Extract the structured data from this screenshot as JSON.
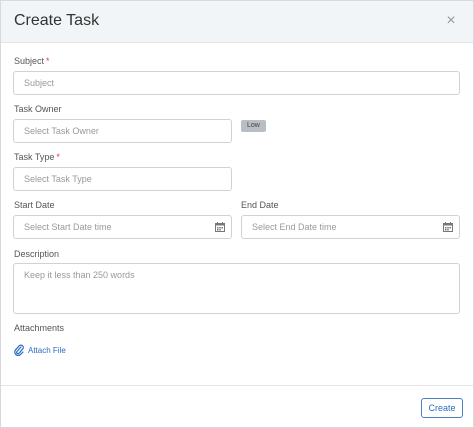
{
  "modal": {
    "title": "Create Task",
    "close_icon": "×"
  },
  "fields": {
    "subject": {
      "label": "Subject",
      "required": "*",
      "placeholder": "Subject",
      "value": ""
    },
    "task_owner": {
      "label": "Task Owner",
      "placeholder": "Select Task Owner",
      "value": "",
      "priority_badge": "Low"
    },
    "task_type": {
      "label": "Task Type",
      "required": "*",
      "placeholder": "Select Task Type",
      "value": ""
    },
    "start_date": {
      "label": "Start Date",
      "placeholder": "Select Start Date time",
      "value": "",
      "icon": "calendar-icon"
    },
    "end_date": {
      "label": "End Date",
      "placeholder": "Select End Date time",
      "value": "",
      "icon": "calendar-icon"
    },
    "description": {
      "label": "Description",
      "placeholder": "Keep it less than 250 words",
      "value": ""
    }
  },
  "attachments": {
    "label": "Attachments",
    "link_label": "Attach File",
    "icon": "paperclip-icon"
  },
  "footer": {
    "create_label": "Create"
  },
  "colors": {
    "header_bg": "#f2f5f7",
    "link": "#2b6bbf",
    "required": "#e53935",
    "badge_bg": "#b8bec3"
  }
}
